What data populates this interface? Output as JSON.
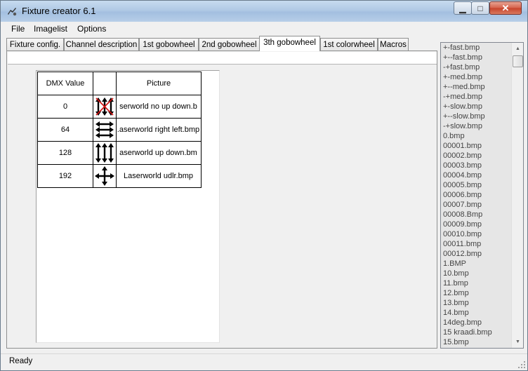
{
  "window": {
    "title": "Fixture creator 6.1",
    "controls": {
      "minimize": "▁",
      "maximize": "□",
      "close": "✕"
    }
  },
  "menu": {
    "items": [
      "File",
      "Imagelist",
      "Options"
    ]
  },
  "tabs": [
    "Fixture config.",
    "Channel description",
    "1st gobowheel",
    "2nd gobowheel",
    "3th gobowheel",
    "1st colorwheel",
    "Macros"
  ],
  "active_tab": "3th gobowheel",
  "grid": {
    "headers": {
      "dmx": "DMX Value",
      "icon": "",
      "picture": "Picture"
    },
    "rows": [
      {
        "dmx": "0",
        "icon": "no-up-down-arrows-icon",
        "picture": "serworld no up down.b"
      },
      {
        "dmx": "64",
        "icon": "right-left-arrows-icon",
        "picture": ".aserworld right left.bmp"
      },
      {
        "dmx": "128",
        "icon": "up-down-arrows-icon",
        "picture": "aserworld up down.bm"
      },
      {
        "dmx": "192",
        "icon": "four-way-arrows-icon",
        "picture": "Laserworld udlr.bmp"
      }
    ]
  },
  "imagelist": [
    "+-fast.bmp",
    "+--fast.bmp",
    "-+fast.bmp",
    "+-med.bmp",
    "+--med.bmp",
    "-+med.bmp",
    "+-slow.bmp",
    "+--slow.bmp",
    "-+slow.bmp",
    "0.bmp",
    "00001.bmp",
    "00002.bmp",
    "00003.bmp",
    "00004.bmp",
    "00005.bmp",
    "00006.bmp",
    "00007.bmp",
    "00008.Bmp",
    "00009.bmp",
    "00010.bmp",
    "00011.bmp",
    "00012.bmp",
    "1.BMP",
    "10.bmp",
    "11.bmp",
    "12.bmp",
    "13.bmp",
    "14.bmp",
    "14deg.bmp",
    "15 kraadi.bmp",
    "15.bmp"
  ],
  "status": {
    "text": "Ready"
  },
  "colors": {
    "accent_red": "#d01010",
    "titlebar": "#b0c9e5",
    "list_bg": "#e6e6e6"
  }
}
